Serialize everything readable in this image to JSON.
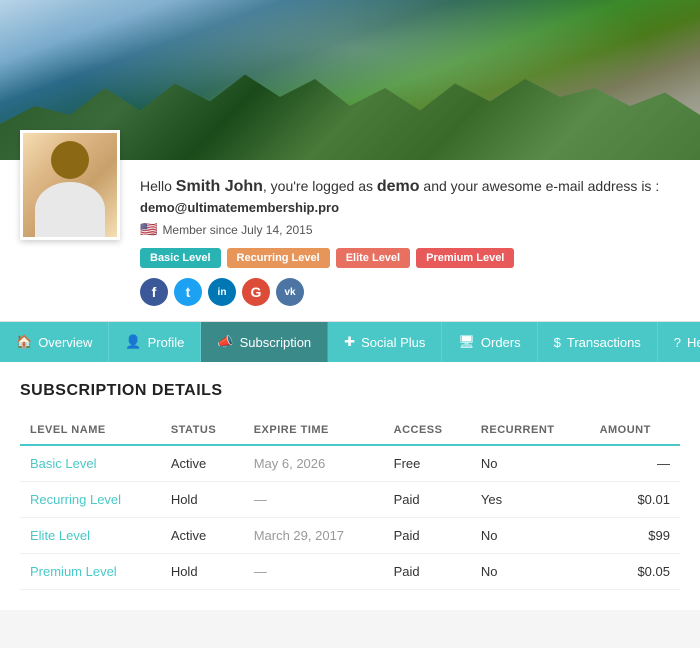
{
  "hero": {
    "alt": "Mountain landscape banner"
  },
  "profile": {
    "greeting_prefix": "Hello ",
    "name": "Smith John",
    "greeting_mid": ", you're logged as ",
    "username": "demo",
    "greeting_suffix": " and your awesome e-mail address is :",
    "email": "demo@ultimatemembership.pro",
    "member_since": "Member since July 14, 2015",
    "flag": "🇺🇸",
    "badges": [
      {
        "label": "Basic Level",
        "class": "badge-teal"
      },
      {
        "label": "Recurring Level",
        "class": "badge-orange"
      },
      {
        "label": "Elite Level",
        "class": "badge-coral"
      },
      {
        "label": "Premium Level",
        "class": "badge-salmon"
      }
    ],
    "social": [
      {
        "name": "facebook",
        "letter": "f",
        "class": "si-fb"
      },
      {
        "name": "twitter",
        "letter": "t",
        "class": "si-tw"
      },
      {
        "name": "linkedin",
        "letter": "in",
        "class": "si-li"
      },
      {
        "name": "google",
        "letter": "G",
        "class": "si-go"
      },
      {
        "name": "vk",
        "letter": "vk",
        "class": "si-vk"
      }
    ]
  },
  "nav": {
    "items": [
      {
        "id": "overview",
        "icon": "🏠",
        "label": "Overview",
        "active": false
      },
      {
        "id": "profile",
        "icon": "👤",
        "label": "Profile",
        "active": false
      },
      {
        "id": "subscription",
        "icon": "📣",
        "label": "Subscription",
        "active": true
      },
      {
        "id": "social-plus",
        "icon": "+",
        "label": "Social Plus",
        "active": false
      },
      {
        "id": "orders",
        "icon": "🖥",
        "label": "Orders",
        "active": false
      },
      {
        "id": "transactions",
        "icon": "$",
        "label": "Transactions",
        "active": false
      },
      {
        "id": "help",
        "icon": "?",
        "label": "Help",
        "active": false
      },
      {
        "id": "logout",
        "icon": "↪",
        "label": "",
        "active": false
      }
    ]
  },
  "subscription": {
    "section_title": "SUBSCRIPTION DETAILS",
    "table": {
      "headers": [
        "LEVEL NAME",
        "STATUS",
        "EXPIRE TIME",
        "ACCESS",
        "RECURRENT",
        "AMOUNT"
      ],
      "rows": [
        {
          "level": "Basic Level",
          "status": "Active",
          "expire": "May 6, 2026",
          "access": "Free",
          "recurrent": "No",
          "amount": "—"
        },
        {
          "level": "Recurring Level",
          "status": "Hold",
          "expire": "—",
          "access": "Paid",
          "recurrent": "Yes",
          "amount": "$0.01"
        },
        {
          "level": "Elite Level",
          "status": "Active",
          "expire": "March 29, 2017",
          "access": "Paid",
          "recurrent": "No",
          "amount": "$99"
        },
        {
          "level": "Premium Level",
          "status": "Hold",
          "expire": "—",
          "access": "Paid",
          "recurrent": "No",
          "amount": "$0.05"
        }
      ]
    }
  }
}
